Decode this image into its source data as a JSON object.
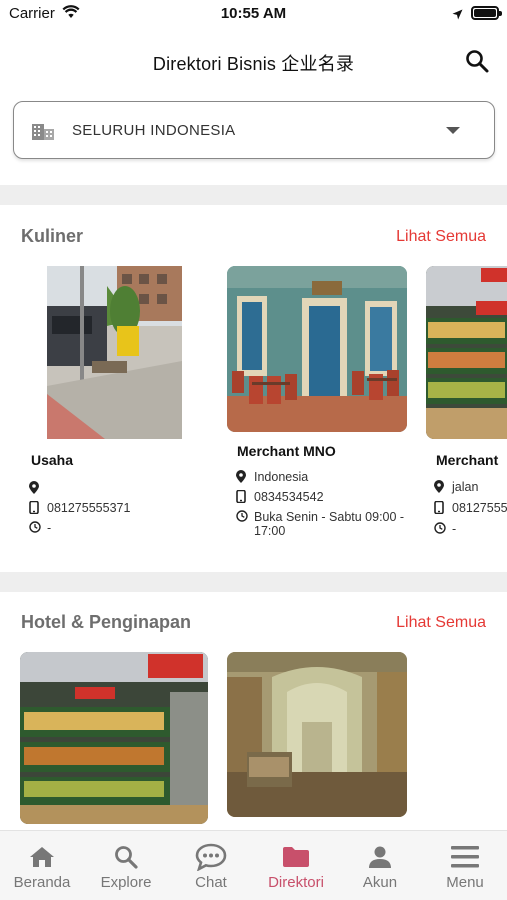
{
  "status_bar": {
    "carrier": "Carrier",
    "time": "10:55 AM"
  },
  "header": {
    "title": "Direktori Bisnis 企业名录"
  },
  "region_select": {
    "value": "SELURUH INDONESIA"
  },
  "sections": [
    {
      "title": "Kuliner",
      "see_all": "Lihat Semua",
      "cards": [
        {
          "name": "Usaha",
          "location": "",
          "phone": "081275555371",
          "hours": "-"
        },
        {
          "name": "Merchant MNO",
          "location": "Indonesia",
          "phone": "0834534542",
          "hours": "Buka Senin - Sabtu 09:00 - 17:00"
        },
        {
          "name": "Merchant",
          "location": "jalan",
          "phone": "08127555",
          "hours": "-"
        }
      ]
    },
    {
      "title": "Hotel & Penginapan",
      "see_all": "Lihat Semua",
      "cards": []
    }
  ],
  "bottom_nav": [
    {
      "label": "Beranda",
      "icon": "home-icon"
    },
    {
      "label": "Explore",
      "icon": "search-icon"
    },
    {
      "label": "Chat",
      "icon": "chat-bubble-icon"
    },
    {
      "label": "Direktori",
      "icon": "folder-icon",
      "active": true
    },
    {
      "label": "Akun",
      "icon": "person-icon"
    },
    {
      "label": "Menu",
      "icon": "hamburger-menu-icon"
    }
  ],
  "colors": {
    "accent": "#e53935",
    "active_nav": "#c8506b",
    "inactive_nav": "#777777",
    "section_title": "#6e6e6e"
  }
}
